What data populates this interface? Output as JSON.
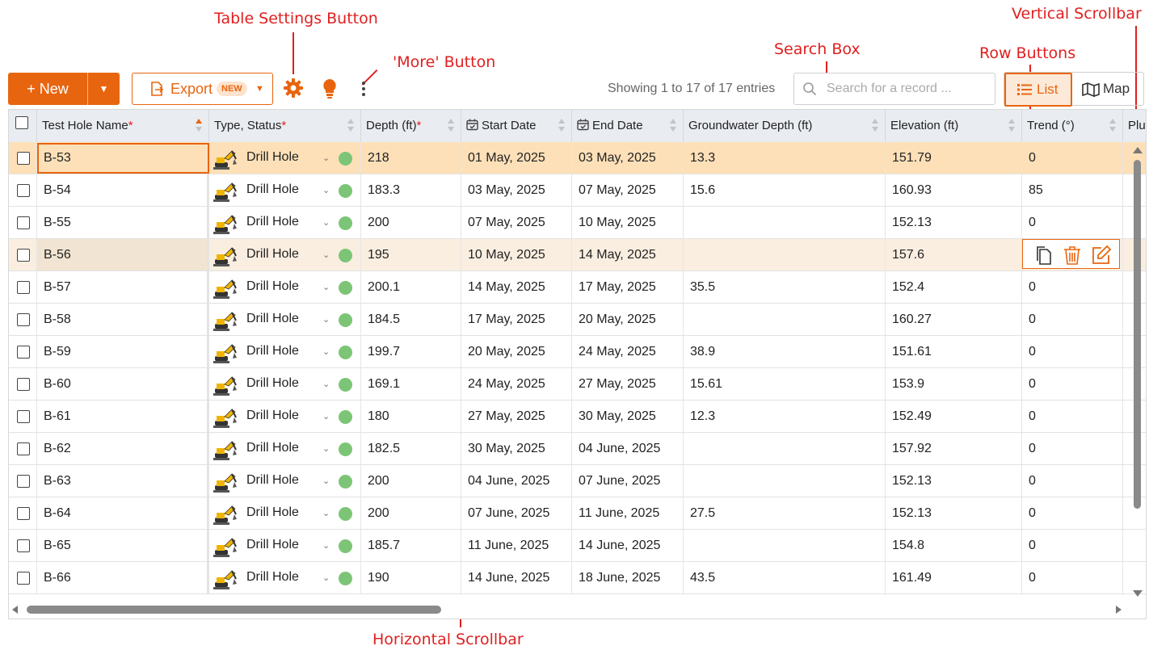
{
  "annotations": {
    "table_settings": "Table Settings Button",
    "more": "'More' Button",
    "search": "Search Box",
    "row_buttons": "Row Buttons",
    "vertical_scrollbar": "Vertical Scrollbar",
    "horizontal_scrollbar": "Horizontal Scrollbar"
  },
  "toolbar": {
    "new_label": "+ New",
    "export_label": "Export",
    "export_badge": "NEW",
    "entries": "Showing 1 to 17 of 17 entries",
    "search_placeholder": "Search for a record ...",
    "list_label": "List",
    "map_label": "Map",
    "settings_icon": "gear-icon",
    "tip_icon": "lightbulb-icon",
    "more_icon": "vertical-ellipsis-icon"
  },
  "colors": {
    "accent": "#e8650f",
    "annotation": "#e02020",
    "selected_row": "#fde0b8",
    "status_green": "#7cc576"
  },
  "columns": [
    {
      "label": "Test Hole Name",
      "required": "*"
    },
    {
      "label": "Type, Status",
      "required": "*"
    },
    {
      "label": "Depth (ft)",
      "required": "*"
    },
    {
      "label": "Start Date",
      "required": ""
    },
    {
      "label": "End Date",
      "required": ""
    },
    {
      "label": "Groundwater Depth (ft)",
      "required": ""
    },
    {
      "label": "Elevation (ft)",
      "required": ""
    },
    {
      "label": "Trend (°)",
      "required": ""
    },
    {
      "label": "Plu",
      "required": ""
    }
  ],
  "rows": [
    {
      "name": "B-53",
      "type": "Drill Hole",
      "depth": "218",
      "start": "01 May, 2025",
      "end": "03 May, 2025",
      "gw": "13.3",
      "elev": "151.79",
      "trend": "0"
    },
    {
      "name": "B-54",
      "type": "Drill Hole",
      "depth": "183.3",
      "start": "03 May, 2025",
      "end": "07 May, 2025",
      "gw": "15.6",
      "elev": "160.93",
      "trend": "85"
    },
    {
      "name": "B-55",
      "type": "Drill Hole",
      "depth": "200",
      "start": "07 May, 2025",
      "end": "10 May, 2025",
      "gw": "",
      "elev": "152.13",
      "trend": "0"
    },
    {
      "name": "B-56",
      "type": "Drill Hole",
      "depth": "195",
      "start": "10 May, 2025",
      "end": "14 May, 2025",
      "gw": "",
      "elev": "157.6",
      "trend": ""
    },
    {
      "name": "B-57",
      "type": "Drill Hole",
      "depth": "200.1",
      "start": "14 May, 2025",
      "end": "17 May, 2025",
      "gw": "35.5",
      "elev": "152.4",
      "trend": "0"
    },
    {
      "name": "B-58",
      "type": "Drill Hole",
      "depth": "184.5",
      "start": "17 May, 2025",
      "end": "20 May, 2025",
      "gw": "",
      "elev": "160.27",
      "trend": "0"
    },
    {
      "name": "B-59",
      "type": "Drill Hole",
      "depth": "199.7",
      "start": "20 May, 2025",
      "end": "24 May, 2025",
      "gw": "38.9",
      "elev": "151.61",
      "trend": "0"
    },
    {
      "name": "B-60",
      "type": "Drill Hole",
      "depth": "169.1",
      "start": "24 May, 2025",
      "end": "27 May, 2025",
      "gw": "15.61",
      "elev": "153.9",
      "trend": "0"
    },
    {
      "name": "B-61",
      "type": "Drill Hole",
      "depth": "180",
      "start": "27 May, 2025",
      "end": "30 May, 2025",
      "gw": "12.3",
      "elev": "152.49",
      "trend": "0"
    },
    {
      "name": "B-62",
      "type": "Drill Hole",
      "depth": "182.5",
      "start": "30 May, 2025",
      "end": "04 June, 2025",
      "gw": "",
      "elev": "157.92",
      "trend": "0"
    },
    {
      "name": "B-63",
      "type": "Drill Hole",
      "depth": "200",
      "start": "04 June, 2025",
      "end": "07 June, 2025",
      "gw": "",
      "elev": "152.13",
      "trend": "0"
    },
    {
      "name": "B-64",
      "type": "Drill Hole",
      "depth": "200",
      "start": "07 June, 2025",
      "end": "11 June, 2025",
      "gw": "27.5",
      "elev": "152.13",
      "trend": "0"
    },
    {
      "name": "B-65",
      "type": "Drill Hole",
      "depth": "185.7",
      "start": "11 June, 2025",
      "end": "14 June, 2025",
      "gw": "",
      "elev": "154.8",
      "trend": "0"
    },
    {
      "name": "B-66",
      "type": "Drill Hole",
      "depth": "190",
      "start": "14 June, 2025",
      "end": "18 June, 2025",
      "gw": "43.5",
      "elev": "161.49",
      "trend": "0"
    }
  ],
  "row_actions": [
    "copy-icon",
    "trash-icon",
    "edit-icon"
  ]
}
